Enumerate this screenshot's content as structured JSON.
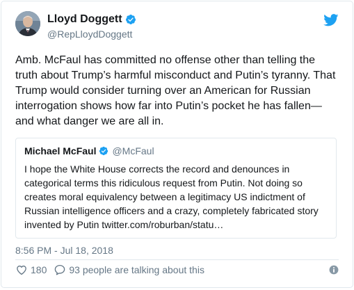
{
  "tweet": {
    "author": {
      "display_name": "Lloyd Doggett",
      "screen_name": "@RepLloydDoggett",
      "verified_icon": "verified-badge-icon"
    },
    "platform_icon": "twitter-bird-icon",
    "text": "Amb. McFaul has committed no offense other than telling the truth about Trump’s harmful misconduct and Putin’s tyranny. That Trump would consider turning over an American for Russian interrogation shows how far into Putin’s pocket he has fallen—and what danger we are all in.",
    "quoted": {
      "display_name": "Michael McFaul",
      "screen_name": "@McFaul",
      "text": "I hope the White House corrects the record and denounces in categorical terms this ridiculous request from Putin. Not doing so creates moral equivalency between a legitimacy US indictment of Russian intelligence officers and a crazy, completely fabricated story invented by Putin twitter.com/roburban/statu…"
    },
    "timestamp": "8:56 PM - Jul 18, 2018",
    "actions": {
      "likes_count": "180",
      "talking_label": "93 people are talking about this"
    }
  },
  "colors": {
    "brand_blue": "#1da1f2",
    "text_primary": "#14171a",
    "text_secondary": "#657786",
    "border": "#e1e8ed"
  }
}
